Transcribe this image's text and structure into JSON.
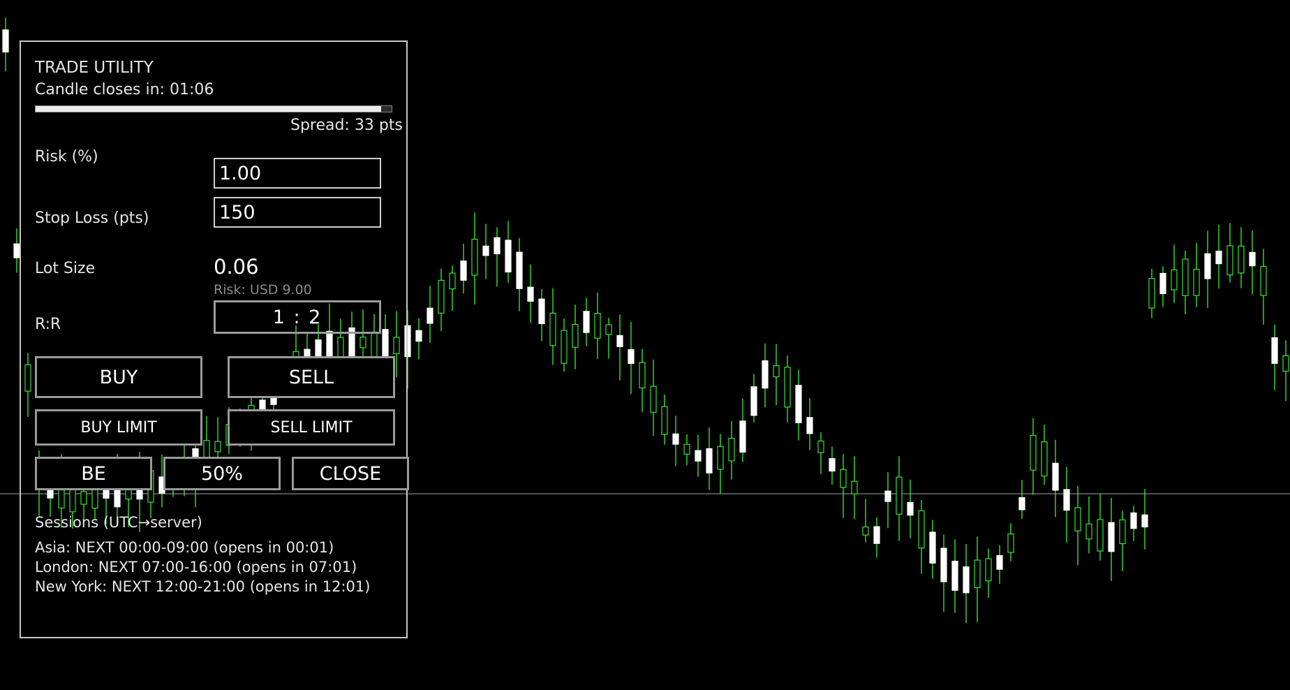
{
  "chart": {
    "bull_color": "#ffffff",
    "wick_color": "#33e62a",
    "background": "#000000",
    "hline_color": "#9fa6ad"
  },
  "panel": {
    "title": "TRADE UTILITY",
    "candle_closes_label": "Candle closes in: 01:06",
    "candle_progress_fraction": 0.97,
    "spread_label": "Spread: 33 pts",
    "risk_label": "Risk (%)",
    "risk_value": "1.00",
    "stop_loss_label": "Stop Loss (pts)",
    "stop_loss_value": "150",
    "lot_size_label": "Lot Size",
    "lot_size_value": "0.06",
    "risk_usd_label": "Risk: USD 9.00",
    "rr_label": "R:R",
    "rr_value": "1 : 2",
    "buttons": {
      "buy": "BUY",
      "sell": "SELL",
      "buy_limit": "BUY LIMIT",
      "sell_limit": "SELL LIMIT",
      "be": "BE",
      "fifty": "50%",
      "close": "CLOSE"
    },
    "sessions": {
      "title": "Sessions (UTC→server)",
      "lines": [
        "Asia: NEXT  00:00-09:00  (opens in 00:01)",
        "London: NEXT  07:00-16:00  (opens in 07:01)",
        "New York: NEXT  12:00-21:00  (opens in 12:01)"
      ]
    }
  }
}
